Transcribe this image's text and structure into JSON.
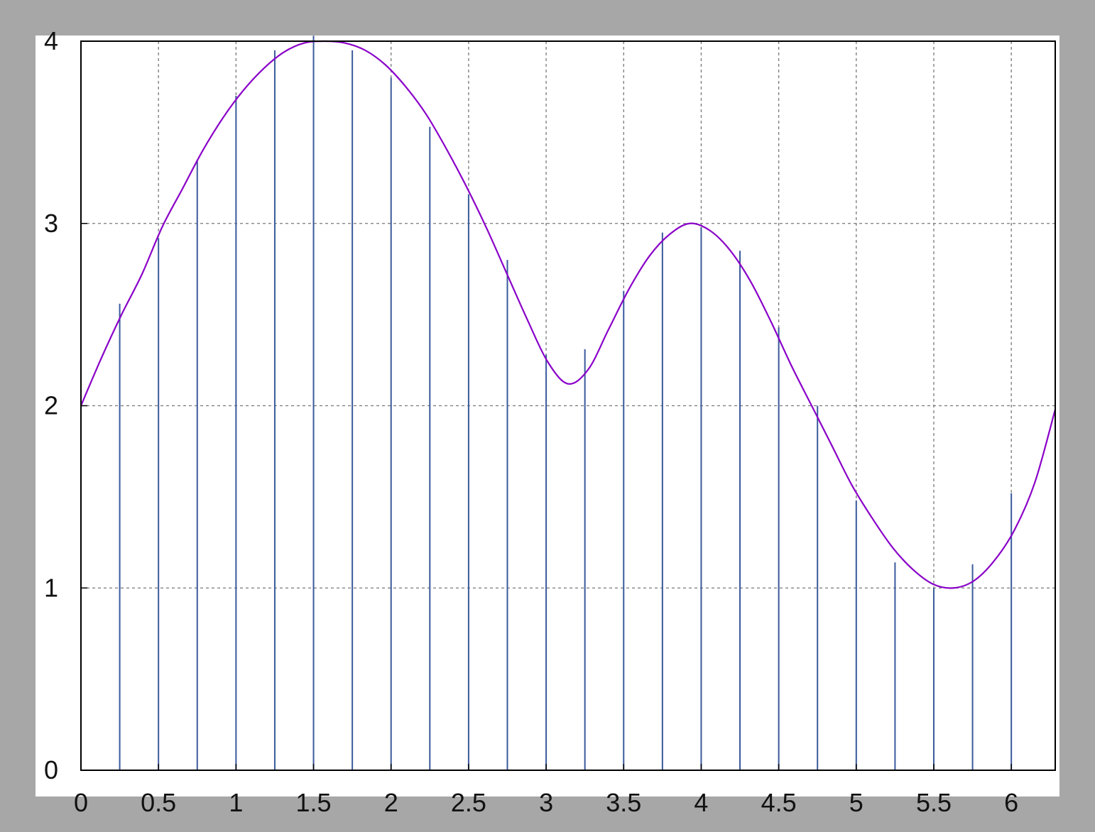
{
  "colors": {
    "frame_background": "#a7a7a7",
    "plot_background": "#ffffff",
    "curve": "#8a00c8",
    "stems": "#3a5a9c",
    "grid": "#777777",
    "axes": "#000000"
  },
  "chart_data": {
    "type": "line",
    "title": "",
    "xlabel": "",
    "ylabel": "",
    "xlim": [
      0,
      6.2832
    ],
    "ylim": [
      0,
      4
    ],
    "grid": true,
    "legend": "none",
    "xticks": [
      "0",
      "0.5",
      "1",
      "1.5",
      "2",
      "2.5",
      "3",
      "3.5",
      "4",
      "4.5",
      "5",
      "5.5",
      "6"
    ],
    "yticks": [
      "0",
      "1",
      "2",
      "3",
      "4"
    ],
    "series": [
      {
        "style": "line",
        "x": [
          0,
          0.1309,
          0.2618,
          0.3927,
          0.5236,
          0.6545,
          0.7854,
          0.9163,
          1.0472,
          1.1781,
          1.309,
          1.4399,
          1.5708,
          1.7017,
          1.8326,
          1.9635,
          2.0944,
          2.2253,
          2.3562,
          2.4871,
          2.618,
          2.7489,
          2.8798,
          3.0107,
          3.1416,
          3.2725,
          3.4034,
          3.5343,
          3.6652,
          3.7961,
          3.927,
          4.0579,
          4.1888,
          4.3197,
          4.4506,
          4.5815,
          4.7124,
          4.8433,
          4.9742,
          5.1051,
          5.236,
          5.3669,
          5.4978,
          5.6287,
          5.7596,
          5.8905,
          6.0214,
          6.1523,
          6.2832
        ],
        "y": [
          2.0,
          2.26,
          2.5,
          2.72,
          2.98,
          3.19,
          3.4,
          3.58,
          3.73,
          3.85,
          3.94,
          3.99,
          4.0,
          3.99,
          3.95,
          3.87,
          3.75,
          3.6,
          3.41,
          3.2,
          2.97,
          2.72,
          2.47,
          2.24,
          2.12,
          2.2,
          2.42,
          2.64,
          2.82,
          2.94,
          3.0,
          2.96,
          2.85,
          2.68,
          2.46,
          2.22,
          2.0,
          1.78,
          1.56,
          1.38,
          1.22,
          1.1,
          1.02,
          1.0,
          1.04,
          1.15,
          1.32,
          1.58,
          1.98
        ]
      },
      {
        "style": "stem",
        "x": [
          0.25,
          0.5,
          0.75,
          1.0,
          1.25,
          1.5,
          1.75,
          2.0,
          2.25,
          2.5,
          2.75,
          3.0,
          3.25,
          3.5,
          3.75,
          4.0,
          4.25,
          4.5,
          4.75,
          5.0,
          5.25,
          5.5,
          5.75,
          6.0
        ],
        "y": [
          2.56,
          2.92,
          3.35,
          3.7,
          3.95,
          4.03,
          3.95,
          3.8,
          3.53,
          3.16,
          2.8,
          2.28,
          2.31,
          2.63,
          2.95,
          2.98,
          2.85,
          2.43,
          2.0,
          1.48,
          1.14,
          1.0,
          1.13,
          1.52
        ]
      }
    ]
  }
}
